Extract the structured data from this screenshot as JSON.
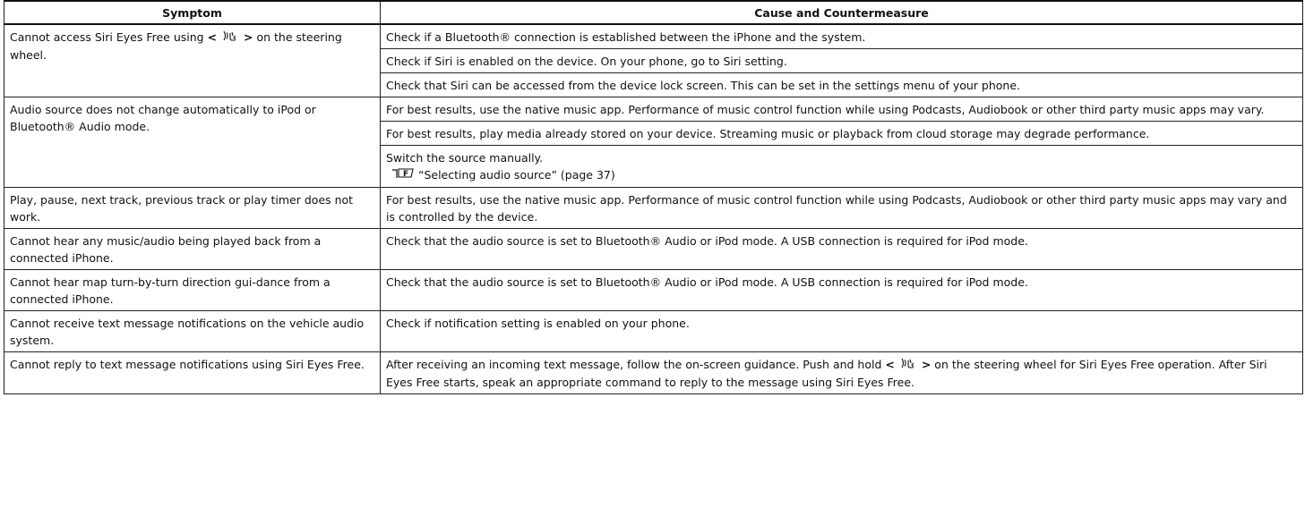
{
  "table": {
    "headers": {
      "symptom": "Symptom",
      "cause": "Cause and Countermeasure"
    },
    "rows": [
      {
        "symptom_before": "Cannot access Siri Eyes Free using ",
        "symptom_lt": "<",
        "symptom_gt": ">",
        "symptom_after": " on the steering wheel.",
        "causes": [
          "Check if a Bluetooth® connection is established between the iPhone and the system.",
          "Check if Siri is enabled on the device. On your phone, go to Siri setting.",
          "Check that Siri can be accessed from the device lock screen. This can be set in the settings menu of your phone."
        ]
      },
      {
        "symptom": "Audio source does not change automatically to iPod or Bluetooth® Audio mode.",
        "causes": [
          "For best results, use the native music app. Performance of music control function while using Podcasts, Audiobook or other third party music apps may vary.",
          "For best results, play media already stored on your device. Streaming music or playback from cloud storage may degrade performance.",
          "Switch the source manually."
        ],
        "reference": "“Selecting audio source” (page 37)"
      },
      {
        "symptom": "Play, pause, next track, previous track or play timer does not work.",
        "causes": [
          "For best results, use the native music app. Performance of music control function while using Podcasts, Audiobook or other third party music apps may vary and is controlled by the device."
        ]
      },
      {
        "symptom": "Cannot hear any music/audio being played back from a connected iPhone.",
        "causes": [
          "Check that the audio source is set to Bluetooth® Audio or iPod mode. A USB connection is required for iPod mode."
        ]
      },
      {
        "symptom": "Cannot hear map turn-by-turn direction gui-dance from a connected iPhone.",
        "causes": [
          "Check that the audio source is set to Bluetooth® Audio or iPod mode. A USB connection is required for iPod mode."
        ]
      },
      {
        "symptom": "Cannot receive text message notifications on the vehicle audio system.",
        "causes": [
          "Check if notification setting is enabled on your phone."
        ]
      },
      {
        "symptom": "Cannot reply to text message notifications using Siri Eyes Free.",
        "cause_before": "After receiving an incoming text message, follow the on-screen guidance. Push and hold ",
        "cause_lt": "<",
        "cause_gt": ">",
        "cause_after": " on the steering wheel for Siri Eyes Free operation. After Siri Eyes Free starts, speak an appropriate command to reply to the message using Siri Eyes Free."
      }
    ]
  },
  "icons": {
    "voice": "voice-command-icon",
    "reference": "page-reference-icon"
  }
}
